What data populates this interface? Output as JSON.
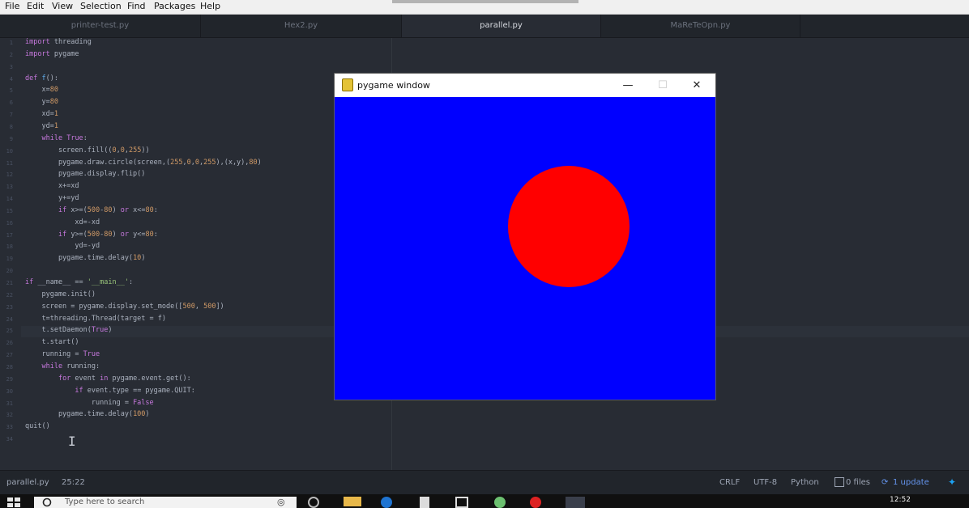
{
  "menu": [
    "File",
    "Edit",
    "View",
    "Selection",
    "Find",
    "Packages",
    "Help"
  ],
  "tabs": [
    {
      "label": "printer-test.py",
      "active": false
    },
    {
      "label": "Hex2.py",
      "active": false
    },
    {
      "label": "parallel.py",
      "active": true
    },
    {
      "label": "MaReTeOpn.py",
      "active": false
    }
  ],
  "code_lines": [
    {
      "n": "1",
      "text": "import threading"
    },
    {
      "n": "2",
      "text": "import pygame"
    },
    {
      "n": "3",
      "text": ""
    },
    {
      "n": "4",
      "text": "def f():"
    },
    {
      "n": "5",
      "text": "    x=80"
    },
    {
      "n": "6",
      "text": "    y=80"
    },
    {
      "n": "7",
      "text": "    xd=1"
    },
    {
      "n": "8",
      "text": "    yd=1"
    },
    {
      "n": "9",
      "text": "    while True:"
    },
    {
      "n": "10",
      "text": "        screen.fill((0,0,255))"
    },
    {
      "n": "11",
      "text": "        pygame.draw.circle(screen,(255,0,0,255),(x,y),80)"
    },
    {
      "n": "12",
      "text": "        pygame.display.flip()"
    },
    {
      "n": "13",
      "text": "        x+=xd"
    },
    {
      "n": "14",
      "text": "        y+=yd"
    },
    {
      "n": "15",
      "text": "        if x>=(500-80) or x<=80:"
    },
    {
      "n": "16",
      "text": "            xd=-xd"
    },
    {
      "n": "17",
      "text": "        if y>=(500-80) or y<=80:"
    },
    {
      "n": "18",
      "text": "            yd=-yd"
    },
    {
      "n": "19",
      "text": "        pygame.time.delay(10)"
    },
    {
      "n": "20",
      "text": ""
    },
    {
      "n": "21",
      "text": "if __name__ == '__main__':"
    },
    {
      "n": "22",
      "text": "    pygame.init()"
    },
    {
      "n": "23",
      "text": "    screen = pygame.display.set_mode([500, 500])"
    },
    {
      "n": "24",
      "text": "    t=threading.Thread(target = f)"
    },
    {
      "n": "25",
      "text": "    t.setDaemon(True)"
    },
    {
      "n": "26",
      "text": "    t.start()"
    },
    {
      "n": "27",
      "text": "    running = True"
    },
    {
      "n": "28",
      "text": "    while running:"
    },
    {
      "n": "29",
      "text": "        for event in pygame.event.get():"
    },
    {
      "n": "30",
      "text": "            if event.type == pygame.QUIT:"
    },
    {
      "n": "31",
      "text": "                running = False"
    },
    {
      "n": "32",
      "text": "        pygame.time.delay(100)"
    },
    {
      "n": "33",
      "text": "quit()"
    },
    {
      "n": "34",
      "text": ""
    }
  ],
  "pygame_window": {
    "title": "pygame window",
    "minimize_glyph": "—",
    "maximize_glyph": "☐",
    "close_glyph": "✕",
    "background_color": "#0000ff",
    "ball_color": "#ff0000"
  },
  "status": {
    "file": "parallel.py",
    "cursor": "25:22",
    "line_ending": "CRLF",
    "encoding": "UTF-8",
    "grammar": "Python",
    "git": "0 files",
    "update": "1 update"
  },
  "taskbar": {
    "search_placeholder": "Type here to search",
    "time": "12:52"
  }
}
